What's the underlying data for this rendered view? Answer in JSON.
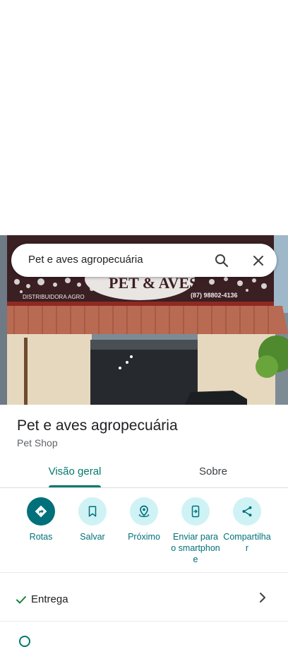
{
  "search": {
    "query": "Pet e aves agropecuária"
  },
  "storefront": {
    "sign_text": "PET & AVES",
    "sign_sub": "DISTRIBUIDORA AGRO",
    "sign_phone": "(87) 98802-4136"
  },
  "place": {
    "title": "Pet e aves agropecuária",
    "category": "Pet Shop"
  },
  "tabs": [
    {
      "label": "Visão geral",
      "selected": true
    },
    {
      "label": "Sobre",
      "selected": false
    }
  ],
  "actions": [
    {
      "label": "Rotas",
      "icon": "directions-icon"
    },
    {
      "label": "Salvar",
      "icon": "bookmark-icon"
    },
    {
      "label": "Próximo",
      "icon": "nearby-icon"
    },
    {
      "label": "Enviar para o smartphone",
      "icon": "send-to-phone-icon"
    },
    {
      "label": "Compartilhar",
      "icon": "share-icon"
    }
  ],
  "details": {
    "delivery": "Entrega"
  },
  "colors": {
    "accent": "#00796b",
    "action_bg": "#cff2f5",
    "action_dark": "#00707a"
  }
}
